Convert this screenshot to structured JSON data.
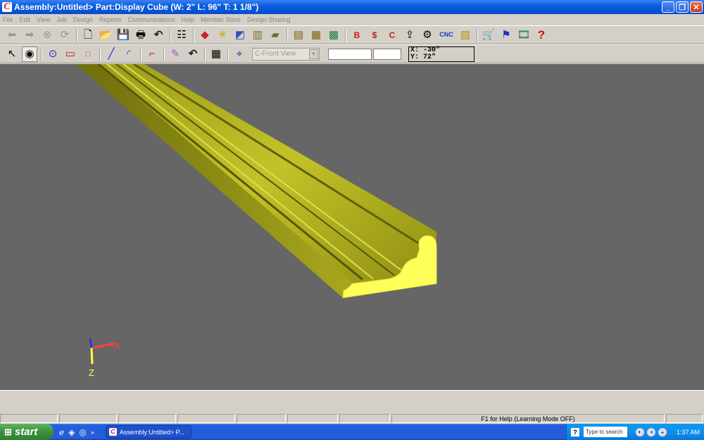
{
  "window": {
    "title": "Assembly:Untitled> Part:Display Cube (W: 2\" L: 96\" T: 1 1/8\")",
    "app_icon": "C"
  },
  "menu": [
    "File",
    "Edit",
    "View",
    "Job",
    "Design",
    "Reports",
    "Communications",
    "Help",
    "Member Store",
    "Design Sharing"
  ],
  "toolbar1": {
    "cnc_label": "CNC",
    "help_glyph": "?"
  },
  "toolbar2": {
    "view_select": "C-Front View",
    "coord_x": "X: -30\"",
    "coord_y": "Y: 72\""
  },
  "axes": {
    "x_label": "X",
    "z_label": "Z"
  },
  "status": {
    "help_text": "F1 for Help (Learning Mode OFF)"
  },
  "taskbar": {
    "start_label": "start",
    "task_label": "Assembly:Untitled> P...",
    "search_placeholder": "Type to search",
    "clock": "1:37 AM"
  },
  "colors": {
    "viewport_bg": "#666666",
    "molding_face": "#ffff5a",
    "molding_dark": "#8a8a10"
  }
}
